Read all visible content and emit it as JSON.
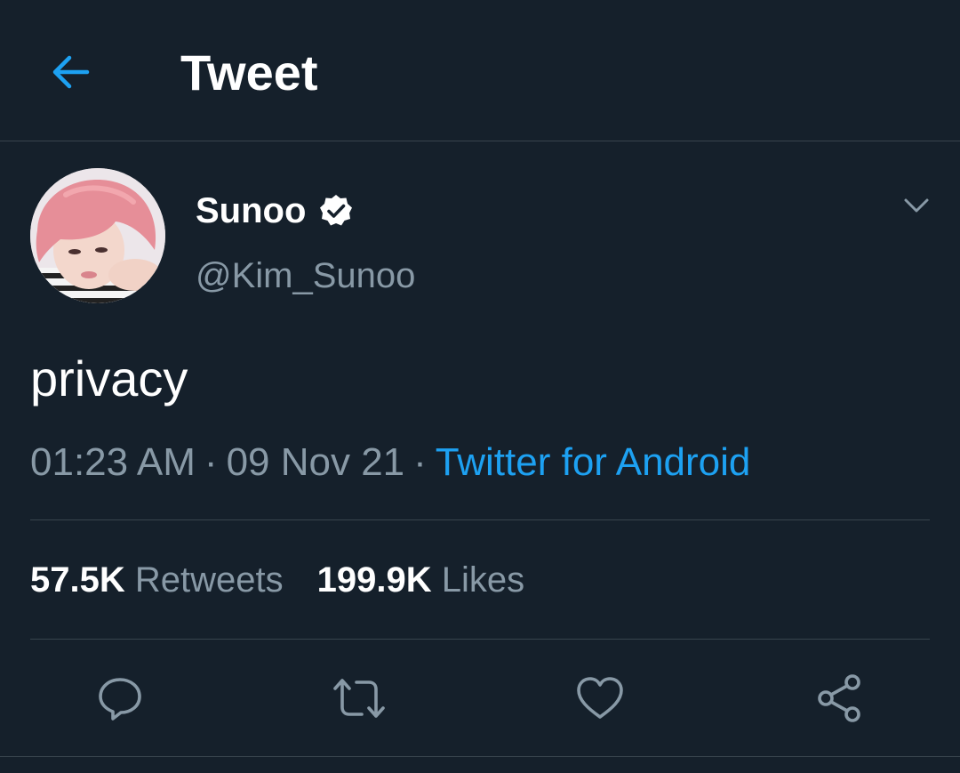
{
  "header": {
    "title": "Tweet",
    "back_icon": "arrow-left-icon"
  },
  "tweet": {
    "author": {
      "display_name": "Sunoo",
      "handle": "@Kim_Sunoo",
      "verified": true
    },
    "text": "privacy",
    "time": "01:23 AM",
    "date": "09 Nov 21",
    "separator": "·",
    "source": "Twitter for Android",
    "stats": {
      "retweets_count": "57.5K",
      "retweets_label": "Retweets",
      "likes_count": "199.9K",
      "likes_label": "Likes"
    }
  },
  "actions": [
    {
      "icon": "reply-icon"
    },
    {
      "icon": "retweet-icon"
    },
    {
      "icon": "like-icon"
    },
    {
      "icon": "share-icon"
    }
  ],
  "colors": {
    "background": "#15202b",
    "accent": "#1da1f2",
    "secondary_text": "#8899a6",
    "divider": "#38444d"
  }
}
